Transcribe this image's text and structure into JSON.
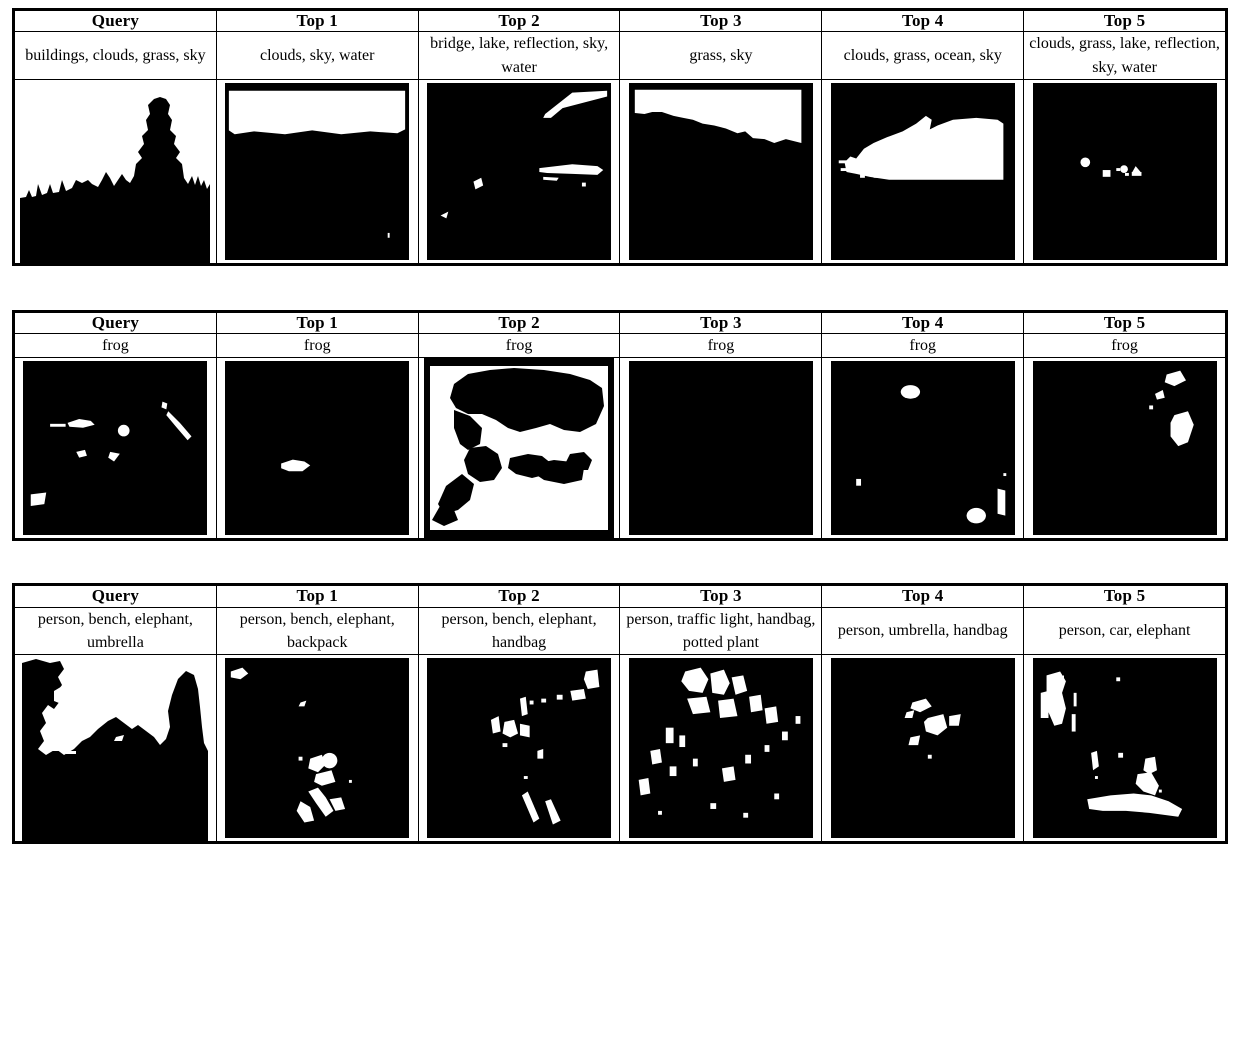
{
  "figure": {
    "type": "retrieval-results-grid",
    "block_count": 3,
    "columns_per_block": 6,
    "colors": {
      "background": "#ffffff",
      "border": "#000000",
      "mask_foreground": "#ffffff",
      "mask_background": "#000000"
    }
  },
  "blocks": [
    {
      "id": "block-1",
      "headers": [
        "Query",
        "Top 1",
        "Top 2",
        "Top 3",
        "Top 4",
        "Top 5"
      ],
      "tags": [
        "buildings, clouds, grass, sky",
        "clouds, sky, water",
        "bridge, lake, reflection, sky, water",
        "grass, sky",
        "clouds, grass, ocean, sky",
        "clouds, grass, lake, reflection, sky, water"
      ],
      "thumbnails": [
        {
          "name": "pagoda-silhouette-mask",
          "style": "silhouette-light"
        },
        {
          "name": "sky-band-mask",
          "style": "mask-dark"
        },
        {
          "name": "bridge-reflection-mask",
          "style": "mask-dark"
        },
        {
          "name": "horizon-skyline-mask",
          "style": "mask-dark"
        },
        {
          "name": "ocean-cloud-blob-mask",
          "style": "mask-dark"
        },
        {
          "name": "sparse-clouds-mask",
          "style": "mask-dark"
        }
      ]
    },
    {
      "id": "block-2",
      "headers": [
        "Query",
        "Top 1",
        "Top 2",
        "Top 3",
        "Top 4",
        "Top 5"
      ],
      "tags": [
        "frog",
        "frog",
        "frog",
        "frog",
        "frog",
        "frog"
      ],
      "thumbnails": [
        {
          "name": "frog-query-speckle-mask",
          "style": "mask-dark"
        },
        {
          "name": "frog-small-blob-mask",
          "style": "mask-dark"
        },
        {
          "name": "frog-silhouette-mask",
          "style": "silhouette-light"
        },
        {
          "name": "frog-empty-mask",
          "style": "mask-dark"
        },
        {
          "name": "frog-two-blobs-mask",
          "style": "mask-dark"
        },
        {
          "name": "frog-corner-blobs-mask",
          "style": "mask-dark"
        }
      ]
    },
    {
      "id": "block-3",
      "headers": [
        "Query",
        "Top 1",
        "Top 2",
        "Top 3",
        "Top 4",
        "Top 5"
      ],
      "tags": [
        "person, bench, elephant, umbrella",
        "person, bench, elephant, backpack",
        "person, bench, elephant, handbag",
        "person, traffic light, handbag, potted plant",
        "person, umbrella, handbag",
        "person, car, elephant"
      ],
      "thumbnails": [
        {
          "name": "crowd-skyline-silhouette-mask",
          "style": "silhouette-light"
        },
        {
          "name": "person-center-mask",
          "style": "mask-dark"
        },
        {
          "name": "person-diagonal-mask",
          "style": "mask-dark"
        },
        {
          "name": "street-scene-mask",
          "style": "mask-dark"
        },
        {
          "name": "person-umbrella-mask",
          "style": "mask-dark"
        },
        {
          "name": "person-elephant-mask",
          "style": "mask-dark"
        }
      ]
    }
  ]
}
